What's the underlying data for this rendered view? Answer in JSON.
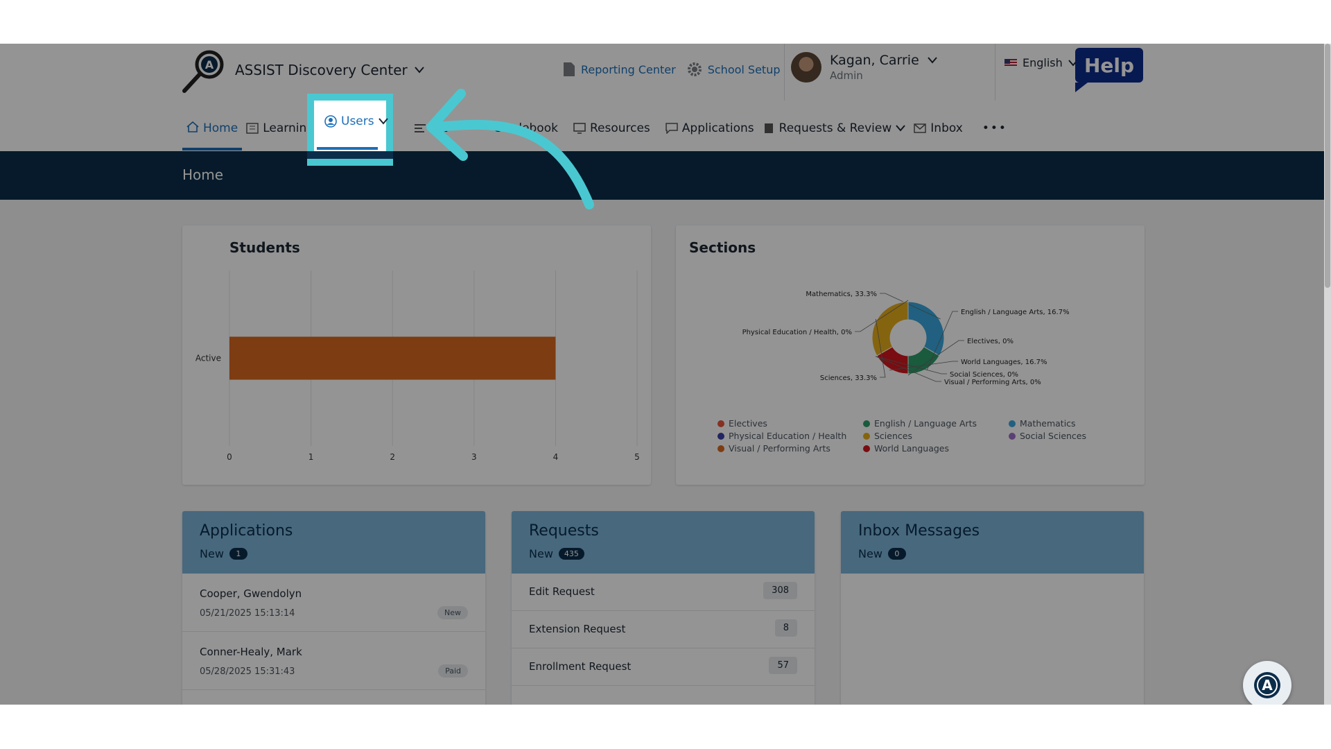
{
  "header": {
    "app_title": "ASSIST Discovery Center",
    "reporting_center": "Reporting Center",
    "school_setup": "School Setup",
    "user_name": "Kagan, Carrie",
    "user_role": "Admin",
    "language": "English",
    "help": "Help"
  },
  "nav": {
    "home": "Home",
    "learning": "Learning",
    "users": "Users",
    "attendance": "Att",
    "gradebook": "Gradebook",
    "resources": "Resources",
    "applications": "Applications",
    "requests_review": "Requests & Review",
    "inbox": "Inbox",
    "more": "•••"
  },
  "banner": {
    "title": "Home"
  },
  "students_card": {
    "title": "Students"
  },
  "sections_card": {
    "title": "Sections"
  },
  "chart_data": [
    {
      "type": "bar",
      "title": "Students",
      "orientation": "horizontal",
      "categories": [
        "Active"
      ],
      "values": [
        4
      ],
      "xlim": [
        0,
        5
      ],
      "x_ticks": [
        "0",
        "1",
        "2",
        "3",
        "4",
        "5"
      ],
      "color": "#d8681f",
      "grid": true
    },
    {
      "type": "pie",
      "title": "Sections",
      "donut": true,
      "slices": [
        {
          "label": "Mathematics, 33.3%",
          "name": "Mathematics",
          "value": 33.3,
          "color": "#3aa6dc"
        },
        {
          "label": "English / Language Arts, 16.7%",
          "name": "English / Language Arts",
          "value": 16.7,
          "color": "#2e9c6a"
        },
        {
          "label": "Electives, 0%",
          "name": "Electives",
          "value": 0,
          "color": "#e5533d"
        },
        {
          "label": "World Languages, 16.7%",
          "name": "World Languages",
          "value": 16.7,
          "color": "#d0181e"
        },
        {
          "label": "Social Sciences, 0%",
          "name": "Social Sciences",
          "value": 0,
          "color": "#9b6fc9"
        },
        {
          "label": "Visual / Performing Arts, 0%",
          "name": "Visual / Performing Arts",
          "value": 0,
          "color": "#d8681f"
        },
        {
          "label": "Sciences, 33.3%",
          "name": "Sciences",
          "value": 33.3,
          "color": "#e6ad1c"
        },
        {
          "label": "Physical Education / Health, 0%",
          "name": "Physical Education / Health",
          "value": 0,
          "color": "#3b3fa8"
        }
      ],
      "legend": [
        {
          "name": "Electives",
          "color": "#e5533d"
        },
        {
          "name": "English / Language Arts",
          "color": "#2e9c6a"
        },
        {
          "name": "Mathematics",
          "color": "#3aa6dc"
        },
        {
          "name": "Physical Education / Health",
          "color": "#3b3fa8"
        },
        {
          "name": "Sciences",
          "color": "#e6ad1c"
        },
        {
          "name": "Social Sciences",
          "color": "#9b6fc9"
        },
        {
          "name": "Visual / Performing Arts",
          "color": "#d8681f"
        },
        {
          "name": "World Languages",
          "color": "#d0181e"
        }
      ],
      "legend_position": "bottom"
    }
  ],
  "applications": {
    "title": "Applications",
    "new_label": "New",
    "new_count": "1",
    "items": [
      {
        "name": "Cooper, Gwendolyn",
        "date": "05/21/2025 15:13:14",
        "status": "New"
      },
      {
        "name": "Conner-Healy, Mark",
        "date": "05/28/2025 15:31:43",
        "status": "Paid"
      }
    ]
  },
  "requests": {
    "title": "Requests",
    "new_label": "New",
    "new_count": "435",
    "items": [
      {
        "name": "Edit Request",
        "count": "308"
      },
      {
        "name": "Extension Request",
        "count": "8"
      },
      {
        "name": "Enrollment Request",
        "count": "57"
      }
    ]
  },
  "inbox": {
    "title": "Inbox Messages",
    "new_label": "New",
    "new_count": "0"
  },
  "colors": {
    "accent": "#1c6fb8",
    "banner": "#0c2d4a",
    "highlight": "#4ac8d1",
    "card_header": "#7ab3d8"
  }
}
